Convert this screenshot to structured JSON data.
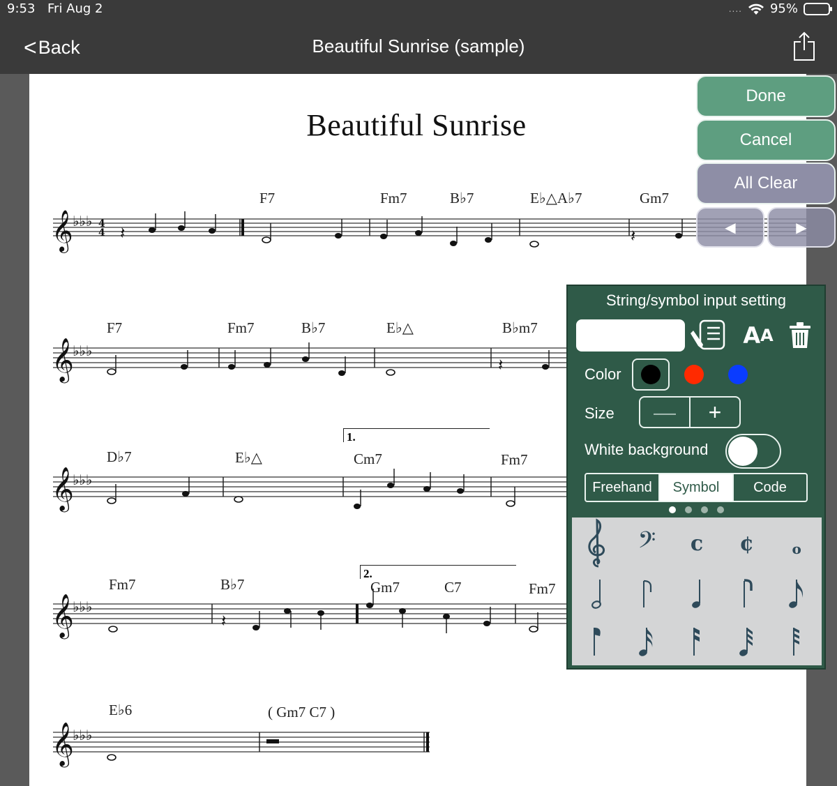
{
  "status": {
    "time": "9:53",
    "date": "Fri Aug 2",
    "signal": "....",
    "battery": "95%"
  },
  "nav": {
    "back_label": "Back",
    "title": "Beautiful Sunrise (sample)"
  },
  "score": {
    "title": "Beautiful Sunrise",
    "chords": [
      "F7",
      "Fm7",
      "B♭7",
      "E♭△A♭7",
      "Gm7",
      "F7",
      "Fm7",
      "B♭7",
      "E♭△",
      "B♭m7",
      "D♭7",
      "E♭△",
      "Cm7",
      "Fm7",
      "Fm7",
      "B♭7",
      "Gm7",
      "C7",
      "Fm7",
      "E♭6",
      "( Gm7 C7 )"
    ],
    "endings": [
      "1.",
      "2."
    ]
  },
  "actions": {
    "done": "Done",
    "cancel": "Cancel",
    "all_clear": "All Clear",
    "prev": "◀",
    "next": "▶"
  },
  "panel": {
    "title": "String/symbol input setting",
    "text_value": "",
    "font_icon_big": "A",
    "font_icon_small": "A",
    "color_label": "Color",
    "size_label": "Size",
    "size_minus": "—",
    "size_plus": "+",
    "white_bg_label": "White background",
    "white_bg_on": false,
    "modes": [
      "Freehand",
      "Symbol",
      "Code"
    ],
    "active_mode": "Symbol",
    "colors": [
      "#000000",
      "#ff2a00",
      "#0a3cff"
    ],
    "selected_color": "#000000",
    "symbols": [
      "treble-clef",
      "bass-clef",
      "common-time",
      "cut-time",
      "whole-note",
      "half-note-down",
      "half-note-up",
      "quarter-note-down",
      "quarter-note-up",
      "eighth-note-up",
      "eighth-note-down",
      "sixteenth-note-up",
      "sixteenth-note-down",
      "thirty-second-note-up",
      "thirty-second-note-down"
    ],
    "symbol_glyphs": {
      "bass_clef": "𝄢",
      "common_time": "c",
      "cut_time": "¢",
      "whole_note": "o"
    }
  }
}
